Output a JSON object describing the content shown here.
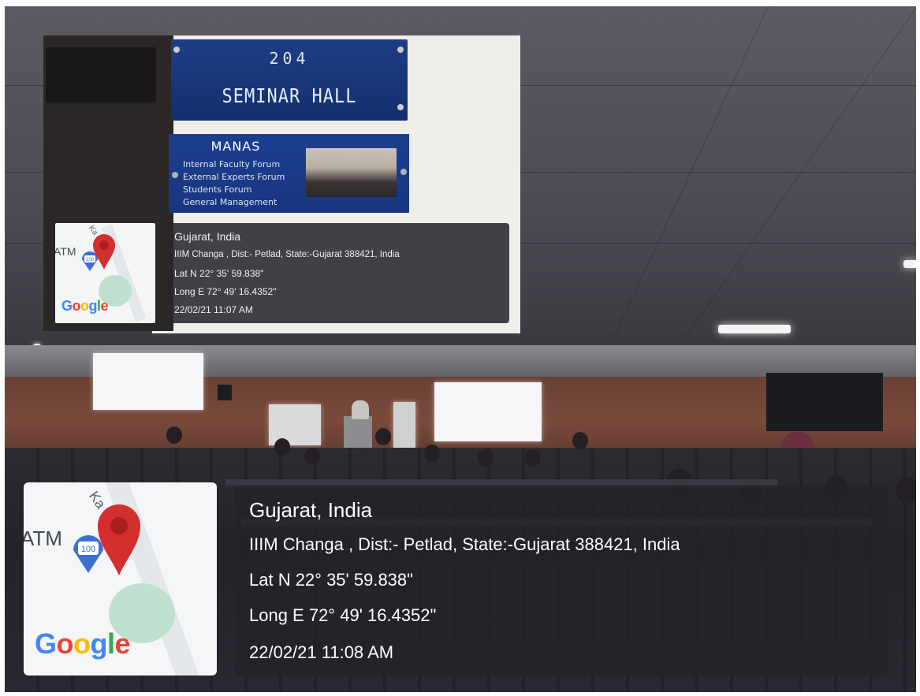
{
  "nameplate": {
    "room_number": "204",
    "room_name": "SEMINAR HALL"
  },
  "manas_plate": {
    "title": "MANAS",
    "lines": [
      "Internal Faculty Forum",
      "External Experts Forum",
      "Students Forum",
      "General Management"
    ]
  },
  "geotag_small": {
    "location": "Gujarat, India",
    "address": "IIIM Changa , Dist:- Petlad, State:-Gujarat 388421, India",
    "latitude": "Lat N 22° 35' 59.838\"",
    "longitude": "Long E 72° 49' 16.4352\"",
    "timestamp": "22/02/21 11:07 AM",
    "map_label": "ATM",
    "map_partial_label": "Ka",
    "poi_badge": "100",
    "pin_icon": "map-pin-icon",
    "pin_color": "#d32f2f",
    "map_logo": "Google"
  },
  "geotag_big": {
    "location": "Gujarat, India",
    "address": "IIIM Changa , Dist:- Petlad, State:-Gujarat 388421, India",
    "latitude": "Lat N 22° 35' 59.838\"",
    "longitude": "Long E 72° 49' 16.4352\"",
    "timestamp": "22/02/21 11:08 AM",
    "map_label": "ATM",
    "map_partial_label": "Ka",
    "poi_badge": "100",
    "pin_icon": "map-pin-icon",
    "pin_color": "#d32f2f",
    "map_logo": "Google"
  }
}
